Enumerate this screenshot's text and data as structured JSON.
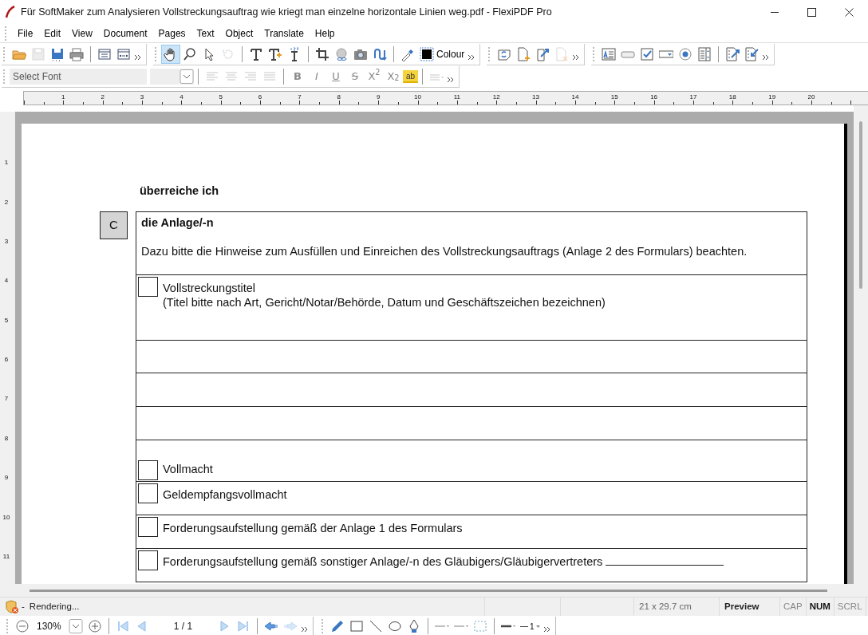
{
  "window": {
    "title": "Für SoftMaker zum Analysieren Vollstreckungsauftrag wie kriegt man einzelne horizontale Linien weg.pdf - FlexiPDF Pro"
  },
  "menu": [
    "File",
    "Edit",
    "View",
    "Document",
    "Pages",
    "Text",
    "Object",
    "Translate",
    "Help"
  ],
  "toolbar_rows": [
    {
      "bands": [
        {
          "groups": [
            [
              {
                "kind": "open",
                "disabled": false
              },
              {
                "kind": "save",
                "disabled": true
              },
              {
                "kind": "save-all",
                "disabled": false
              },
              {
                "kind": "print",
                "disabled": false
              }
            ],
            [
              {
                "kind": "page-view",
                "disabled": false
              },
              {
                "kind": "page-fit",
                "disabled": false
              }
            ]
          ]
        },
        {
          "groups": [
            [
              {
                "kind": "hand",
                "disabled": false,
                "selected": true
              },
              {
                "kind": "zoom",
                "disabled": false,
                "selected": false
              },
              {
                "kind": "pointer",
                "disabled": false,
                "selected": false
              },
              {
                "kind": "rotate",
                "disabled": true,
                "selected": false
              }
            ],
            [
              {
                "kind": "text",
                "disabled": false
              },
              {
                "kind": "text-add",
                "disabled": false
              },
              {
                "kind": "text-number",
                "disabled": false
              }
            ],
            [
              {
                "kind": "crop",
                "disabled": false
              },
              {
                "kind": "link",
                "disabled": false
              },
              {
                "kind": "camera",
                "disabled": false
              },
              {
                "kind": "path",
                "disabled": false
              }
            ],
            [
              {
                "kind": "eyedropper",
                "disabled": false
              },
              {
                "kind": "colour",
                "disabled": false,
                "label": "Colour"
              }
            ]
          ]
        },
        {
          "groups": [
            [
              {
                "kind": "page-rotate",
                "disabled": false
              },
              {
                "kind": "page-add",
                "disabled": false
              },
              {
                "kind": "page-edit",
                "disabled": false
              },
              {
                "kind": "page-delete",
                "disabled": true
              }
            ]
          ]
        },
        {
          "groups": [
            [
              {
                "kind": "text-field",
                "disabled": false
              },
              {
                "kind": "push-button",
                "disabled": false
              },
              {
                "kind": "checkbox",
                "disabled": false
              },
              {
                "kind": "combo",
                "disabled": false
              },
              {
                "kind": "radio",
                "disabled": false
              },
              {
                "kind": "list",
                "disabled": false
              }
            ],
            [
              {
                "kind": "form-edit",
                "disabled": false
              },
              {
                "kind": "form-import",
                "disabled": false
              }
            ]
          ]
        }
      ]
    },
    {
      "bands": [
        {
          "groups": [
            [
              {
                "kind": "font",
                "disabled": true,
                "placeholder": "Select Font"
              },
              {
                "kind": "size",
                "disabled": true
              }
            ],
            [
              {
                "kind": "align-left",
                "disabled": true
              },
              {
                "kind": "align-center",
                "disabled": true
              },
              {
                "kind": "align-right",
                "disabled": true
              },
              {
                "kind": "justify",
                "disabled": true
              }
            ],
            [
              {
                "kind": "bold",
                "disabled": true,
                "label": "B"
              },
              {
                "kind": "italic",
                "disabled": true,
                "label": "I"
              },
              {
                "kind": "underline",
                "disabled": true,
                "label": "U"
              },
              {
                "kind": "strike",
                "disabled": true,
                "label": "S"
              },
              {
                "kind": "superscript",
                "disabled": true,
                "label": "X$^{2}$"
              },
              {
                "kind": "subscript",
                "disabled": true,
                "label": "X$_{2}$"
              },
              {
                "kind": "highlight",
                "disabled": false,
                "label": "ab"
              }
            ],
            [
              {
                "kind": "spacing",
                "disabled": true
              }
            ]
          ]
        }
      ]
    }
  ],
  "ruler": {
    "horizontal": [
      "1",
      "2",
      "3",
      "4",
      "5",
      "6",
      "7",
      "8",
      "9",
      "10",
      "11",
      "12",
      "13",
      "14",
      "15",
      "16",
      "17",
      "18",
      "19",
      "20"
    ],
    "vertical": [
      "1",
      "2",
      "3",
      "4",
      "5",
      "6",
      "7",
      "8",
      "9",
      "10",
      "11"
    ]
  },
  "document": {
    "intro": "überreiche ich",
    "section_letter": "C",
    "section_title": "die Anlage/-n",
    "section_note": "Dazu bitte die Hinweise zum Ausfüllen und Einreichen des Vollstreckungsauftrags (Anlage 2 des Formulars) beachten.",
    "rows": [
      {
        "kind": "checkbox",
        "checked": false,
        "lines": [
          "Vollstreckungstitel",
          "(Titel bitte nach Art, Gericht/Notar/Behörde, Datum und Geschäftszeichen bezeichnen)"
        ]
      },
      {
        "kind": "blank"
      },
      {
        "kind": "blank"
      },
      {
        "kind": "blank"
      },
      {
        "kind": "checkbox",
        "checked": false,
        "lines": [
          "Vollmacht"
        ]
      },
      {
        "kind": "checkbox",
        "checked": false,
        "lines": [
          "Geldempfangsvollmacht"
        ]
      },
      {
        "kind": "checkbox",
        "checked": false,
        "lines": [
          "Forderungsaufstellung gemäß der Anlage 1 des Formulars"
        ]
      },
      {
        "kind": "checkbox",
        "checked": false,
        "lines": [
          "Forderungsaufstellung gemäß sonstiger Anlage/-n des Gläubigers/Gläubigervertreters"
        ],
        "fill_line": true
      }
    ]
  },
  "status_bar": {
    "separator": "-",
    "message": "Rendering...",
    "page_size": "21 x 29.7 cm",
    "mode": "Preview",
    "indicators": [
      {
        "label": "CAP",
        "on": false
      },
      {
        "label": "NUM",
        "on": true
      },
      {
        "label": "SCRL",
        "on": false
      }
    ]
  },
  "bottom_toolbar": {
    "bands": [
      {
        "groups": [
          [
            {
              "kind": "zoom-out",
              "disabled": false
            },
            {
              "kind": "zoom-value",
              "label": "130%"
            },
            {
              "kind": "dropdown",
              "disabled": false
            },
            {
              "kind": "zoom-in",
              "disabled": false
            }
          ],
          [
            {
              "kind": "first",
              "disabled": false
            },
            {
              "kind": "prev",
              "disabled": false
            },
            {
              "kind": "page-count",
              "label": "1 / 1"
            },
            {
              "kind": "next",
              "disabled": false
            },
            {
              "kind": "last",
              "disabled": false
            }
          ],
          [
            {
              "kind": "back",
              "disabled": false
            },
            {
              "kind": "forward",
              "disabled": true
            }
          ]
        ]
      },
      {
        "groups": [
          [
            {
              "kind": "pencil",
              "disabled": false
            },
            {
              "kind": "rectangle",
              "disabled": false
            },
            {
              "kind": "line",
              "disabled": false
            },
            {
              "kind": "ellipse",
              "disabled": false
            },
            {
              "kind": "pen",
              "disabled": false
            }
          ],
          [
            {
              "kind": "line-style",
              "disabled": false
            },
            {
              "kind": "dash-style",
              "disabled": false
            },
            {
              "kind": "grid",
              "disabled": false
            }
          ],
          [
            {
              "kind": "line-width",
              "disabled": false
            },
            {
              "kind": "line-number",
              "disabled": false,
              "label": "1"
            }
          ]
        ]
      }
    ]
  }
}
